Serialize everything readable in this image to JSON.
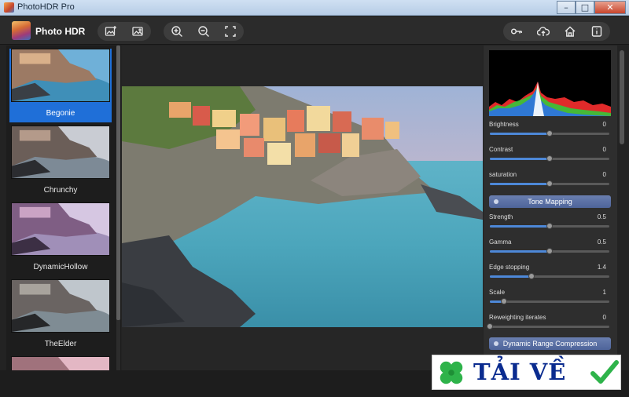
{
  "window": {
    "title": "PhotoHDR Pro",
    "min_glyph": "–",
    "max_glyph": "□",
    "close_glyph": "✕"
  },
  "toolbar": {
    "app_name": "Photo HDR",
    "groups": [
      [
        "add-image-icon",
        "image-icon"
      ],
      [
        "zoom-in-icon",
        "zoom-out-icon",
        "fit-screen-icon"
      ],
      [
        "key-icon",
        "cloud-upload-icon",
        "home-icon",
        "info-icon"
      ]
    ]
  },
  "presets": [
    {
      "label": "Begonie",
      "selected": true
    },
    {
      "label": "Chrunchy",
      "selected": false
    },
    {
      "label": "DynamicHollow",
      "selected": false
    },
    {
      "label": "TheElder",
      "selected": false
    }
  ],
  "controls": {
    "params": [
      {
        "label": "Brightness",
        "value": "0",
        "level": 0.5
      },
      {
        "label": "Contrast",
        "value": "0",
        "level": 0.5
      },
      {
        "label": "saturation",
        "value": "0",
        "level": 0.5
      }
    ],
    "tone_mapping": {
      "title": "Tone Mapping",
      "params": [
        {
          "label": "Strength",
          "value": "0.5",
          "level": 0.5
        },
        {
          "label": "Gamma",
          "value": "0.5",
          "level": 0.5
        },
        {
          "label": "Edge stopping",
          "value": "1.4",
          "level": 0.35
        },
        {
          "label": "Scale",
          "value": "1",
          "level": 0.12
        },
        {
          "label": "Reweighting iterates",
          "value": "0",
          "level": 0.0
        }
      ]
    },
    "dynamic_range": {
      "title": "Dynamic Range Compression"
    }
  },
  "watermark": {
    "text": "TẢI VỀ"
  },
  "colors": {
    "accent": "#1f6fd8",
    "slider_fill": "#4d88d8",
    "section": "#5a70a6"
  }
}
